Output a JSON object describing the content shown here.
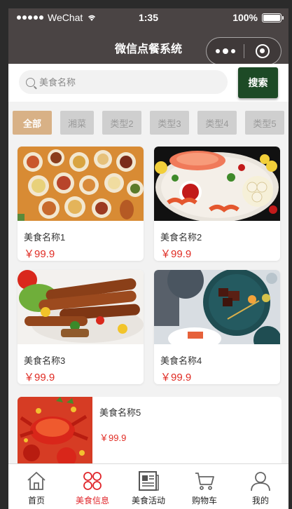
{
  "status_bar": {
    "carrier": "WeChat",
    "time": "1:35",
    "battery": "100%"
  },
  "nav": {
    "title": "微信点餐系统"
  },
  "search": {
    "placeholder": "美食名称",
    "button_label": "搜索"
  },
  "categories": [
    {
      "label": "全部",
      "active": true
    },
    {
      "label": "湘菜",
      "active": false
    },
    {
      "label": "类型2",
      "active": false
    },
    {
      "label": "类型3",
      "active": false
    },
    {
      "label": "类型4",
      "active": false
    },
    {
      "label": "类型5",
      "active": false
    }
  ],
  "foods": [
    {
      "name": "美食名称1",
      "price": "￥99.9",
      "image": "food-platter-image"
    },
    {
      "name": "美食名称2",
      "price": "￥99.9",
      "image": "seafood-platter-image"
    },
    {
      "name": "美食名称3",
      "price": "￥99.9",
      "image": "grilled-sausage-image"
    },
    {
      "name": "美食名称4",
      "price": "￥99.9",
      "image": "steak-plate-image"
    },
    {
      "name": "美食名称5",
      "price": "￥99.9",
      "image": "spicy-crab-image"
    }
  ],
  "tabbar": [
    {
      "label": "首页",
      "icon": "home-icon",
      "active": false
    },
    {
      "label": "美食信息",
      "icon": "food-info-icon",
      "active": true
    },
    {
      "label": "美食活动",
      "icon": "newspaper-icon",
      "active": false
    },
    {
      "label": "购物车",
      "icon": "cart-icon",
      "active": false
    },
    {
      "label": "我的",
      "icon": "user-icon",
      "active": false
    }
  ],
  "colors": {
    "nav_bg": "#4a4444",
    "search_button": "#1d4a26",
    "active_tab": "#d8b186",
    "price": "#e02c24",
    "tabbar_active": "#e0262b"
  }
}
